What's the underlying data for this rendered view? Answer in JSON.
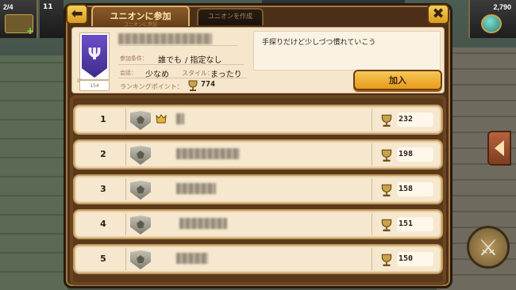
{
  "hud": {
    "left_count": "2/4",
    "left2_count": "11",
    "right_count": "2,790"
  },
  "tabs": {
    "join": "ユニオンに参加",
    "join_sub": "ユニオンに参加",
    "create": "ユニオンを作成"
  },
  "header": {
    "back_icon": "back-arrow-icon",
    "close_icon": "close-x-icon"
  },
  "union": {
    "id_tag": "ID",
    "id_value": "154",
    "join_condition_label": "参加条件：",
    "join_condition_value_1": "誰でも",
    "join_condition_value_2": "/ 指定なし",
    "chat_label": "会話：",
    "chat_value": "少なめ",
    "style_label": "スタイル：",
    "style_value": "まったり",
    "ranking_label": "ランキングポイント：",
    "ranking_points": "774",
    "comment": "手探りだけど少しづつ慣れていこう",
    "join_button": "加入"
  },
  "members": [
    {
      "rank": "1",
      "score": "232",
      "has_badge": true
    },
    {
      "rank": "2",
      "score": "198",
      "has_badge": false
    },
    {
      "rank": "3",
      "score": "158",
      "has_badge": false
    },
    {
      "rank": "4",
      "score": "151",
      "has_badge": false
    },
    {
      "rank": "5",
      "score": "150",
      "has_badge": false
    }
  ],
  "colors": {
    "panel_wood": "#4d2f18",
    "card_bg": "#f5e6cc",
    "button_gold": "#f0b43a",
    "emblem_purple": "#5a3fb0"
  }
}
